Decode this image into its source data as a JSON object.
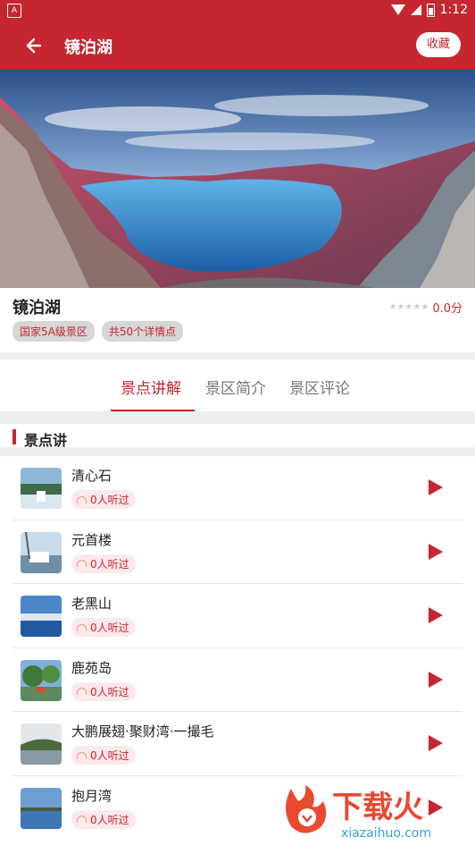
{
  "status": {
    "time": "1:12",
    "left_icon": "A"
  },
  "header": {
    "title": "镜泊湖",
    "favorite_label": "收藏"
  },
  "spot": {
    "name": "镜泊湖",
    "stars": "★★★★★",
    "score": "0.0分",
    "tags": [
      "国家5A级景区",
      "共50个详情点"
    ]
  },
  "tabs": [
    {
      "label": "景点讲解",
      "active": true
    },
    {
      "label": "景区简介",
      "active": false
    },
    {
      "label": "景区评论",
      "active": false
    }
  ],
  "section": {
    "title": "景点讲"
  },
  "items": [
    {
      "name": "清心石",
      "listens": "0人听过"
    },
    {
      "name": "元首楼",
      "listens": "0人听过"
    },
    {
      "name": "老黑山",
      "listens": "0人听过"
    },
    {
      "name": "鹿苑岛",
      "listens": "0人听过"
    },
    {
      "name": "大鹏展翅·聚财湾·一撮毛",
      "listens": "0人听过"
    },
    {
      "name": "抱月湾",
      "listens": "0人听过"
    }
  ],
  "watermark": {
    "text": "下载火",
    "url": "xiazaihuo.com"
  },
  "colors": {
    "accent": "#c6262f"
  }
}
